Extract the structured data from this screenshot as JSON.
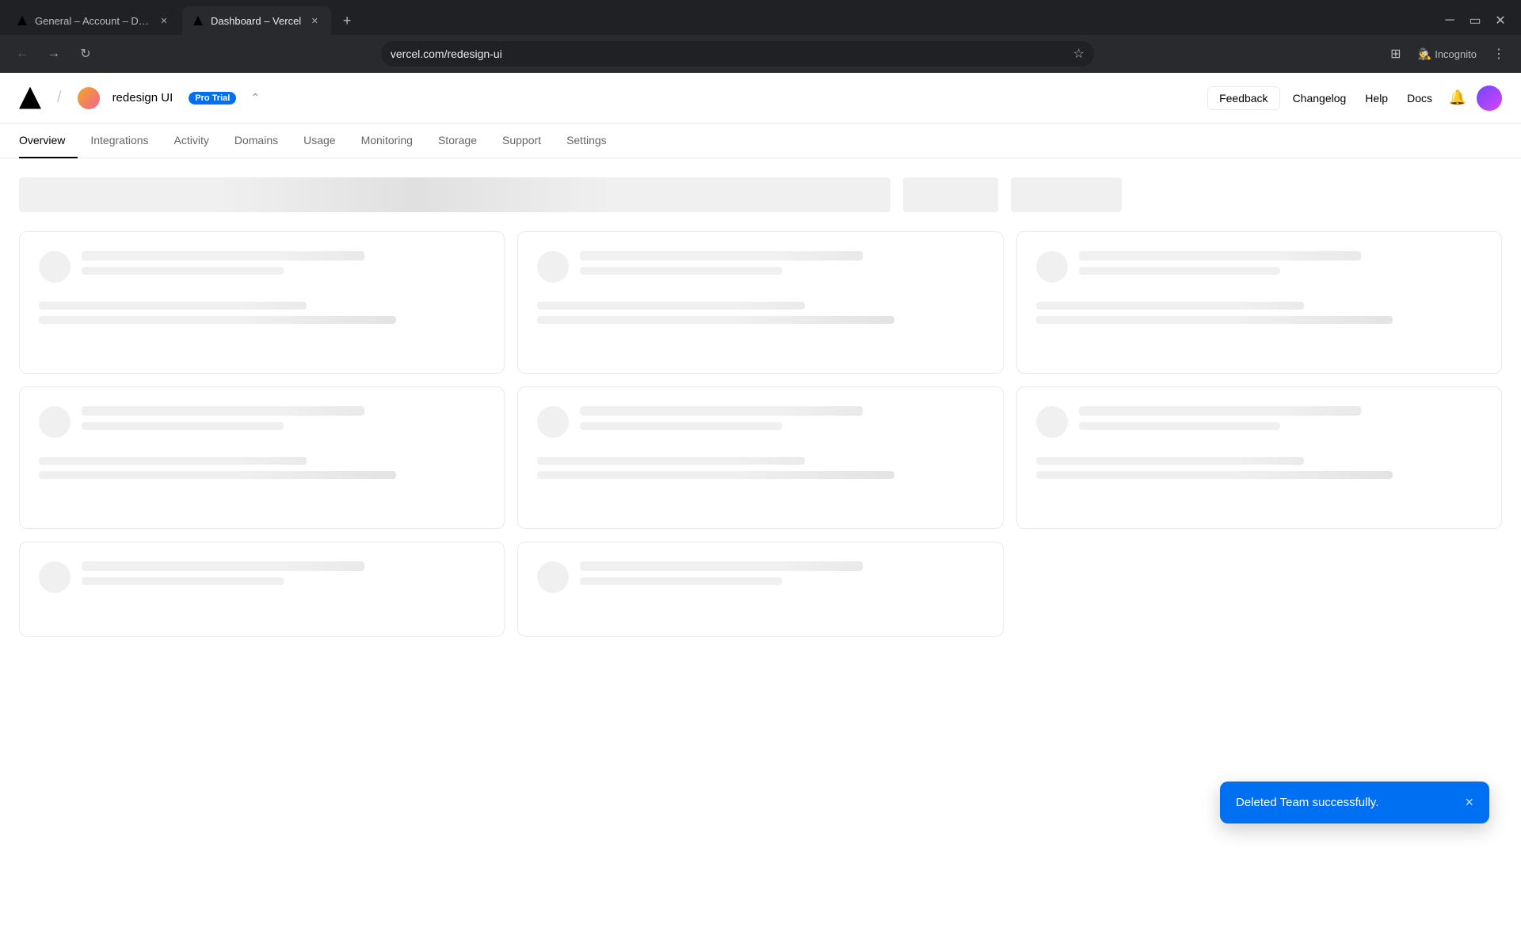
{
  "browser": {
    "tabs": [
      {
        "id": "tab-1",
        "label": "General – Account – Dashboa…",
        "favicon": "triangle",
        "active": false,
        "closable": true
      },
      {
        "id": "tab-2",
        "label": "Dashboard – Vercel",
        "favicon": "triangle",
        "active": true,
        "closable": true
      }
    ],
    "new_tab_label": "+",
    "url": "vercel.com/redesign-ui",
    "incognito_label": "Incognito"
  },
  "topnav": {
    "logo_label": "Vercel",
    "project_name": "redesign UI",
    "badge_label": "Pro Trial",
    "feedback_label": "Feedback",
    "changelog_label": "Changelog",
    "help_label": "Help",
    "docs_label": "Docs"
  },
  "subnav": {
    "items": [
      {
        "id": "overview",
        "label": "Overview",
        "active": true
      },
      {
        "id": "integrations",
        "label": "Integrations",
        "active": false
      },
      {
        "id": "activity",
        "label": "Activity",
        "active": false
      },
      {
        "id": "domains",
        "label": "Domains",
        "active": false
      },
      {
        "id": "usage",
        "label": "Usage",
        "active": false
      },
      {
        "id": "monitoring",
        "label": "Monitoring",
        "active": false
      },
      {
        "id": "storage",
        "label": "Storage",
        "active": false
      },
      {
        "id": "support",
        "label": "Support",
        "active": false
      },
      {
        "id": "settings",
        "label": "Settings",
        "active": false
      }
    ]
  },
  "toast": {
    "message": "Deleted Team successfully.",
    "close_label": "×"
  },
  "cards": [
    {
      "id": "card-1"
    },
    {
      "id": "card-2"
    },
    {
      "id": "card-3"
    },
    {
      "id": "card-4"
    },
    {
      "id": "card-5"
    },
    {
      "id": "card-6"
    },
    {
      "id": "card-7"
    },
    {
      "id": "card-8"
    },
    {
      "id": "card-9"
    }
  ]
}
